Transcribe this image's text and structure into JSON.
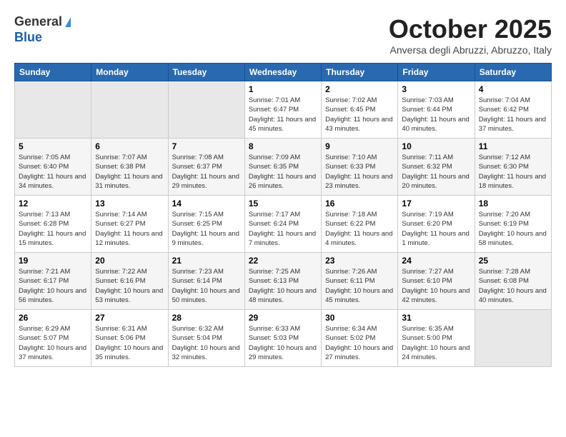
{
  "header": {
    "logo_general": "General",
    "logo_blue": "Blue",
    "month": "October 2025",
    "location": "Anversa degli Abruzzi, Abruzzo, Italy"
  },
  "days_of_week": [
    "Sunday",
    "Monday",
    "Tuesday",
    "Wednesday",
    "Thursday",
    "Friday",
    "Saturday"
  ],
  "weeks": [
    [
      {
        "day": "",
        "content": ""
      },
      {
        "day": "",
        "content": ""
      },
      {
        "day": "",
        "content": ""
      },
      {
        "day": "1",
        "content": "Sunrise: 7:01 AM\nSunset: 6:47 PM\nDaylight: 11 hours and 45 minutes."
      },
      {
        "day": "2",
        "content": "Sunrise: 7:02 AM\nSunset: 6:45 PM\nDaylight: 11 hours and 43 minutes."
      },
      {
        "day": "3",
        "content": "Sunrise: 7:03 AM\nSunset: 6:44 PM\nDaylight: 11 hours and 40 minutes."
      },
      {
        "day": "4",
        "content": "Sunrise: 7:04 AM\nSunset: 6:42 PM\nDaylight: 11 hours and 37 minutes."
      }
    ],
    [
      {
        "day": "5",
        "content": "Sunrise: 7:05 AM\nSunset: 6:40 PM\nDaylight: 11 hours and 34 minutes."
      },
      {
        "day": "6",
        "content": "Sunrise: 7:07 AM\nSunset: 6:38 PM\nDaylight: 11 hours and 31 minutes."
      },
      {
        "day": "7",
        "content": "Sunrise: 7:08 AM\nSunset: 6:37 PM\nDaylight: 11 hours and 29 minutes."
      },
      {
        "day": "8",
        "content": "Sunrise: 7:09 AM\nSunset: 6:35 PM\nDaylight: 11 hours and 26 minutes."
      },
      {
        "day": "9",
        "content": "Sunrise: 7:10 AM\nSunset: 6:33 PM\nDaylight: 11 hours and 23 minutes."
      },
      {
        "day": "10",
        "content": "Sunrise: 7:11 AM\nSunset: 6:32 PM\nDaylight: 11 hours and 20 minutes."
      },
      {
        "day": "11",
        "content": "Sunrise: 7:12 AM\nSunset: 6:30 PM\nDaylight: 11 hours and 18 minutes."
      }
    ],
    [
      {
        "day": "12",
        "content": "Sunrise: 7:13 AM\nSunset: 6:28 PM\nDaylight: 11 hours and 15 minutes."
      },
      {
        "day": "13",
        "content": "Sunrise: 7:14 AM\nSunset: 6:27 PM\nDaylight: 11 hours and 12 minutes."
      },
      {
        "day": "14",
        "content": "Sunrise: 7:15 AM\nSunset: 6:25 PM\nDaylight: 11 hours and 9 minutes."
      },
      {
        "day": "15",
        "content": "Sunrise: 7:17 AM\nSunset: 6:24 PM\nDaylight: 11 hours and 7 minutes."
      },
      {
        "day": "16",
        "content": "Sunrise: 7:18 AM\nSunset: 6:22 PM\nDaylight: 11 hours and 4 minutes."
      },
      {
        "day": "17",
        "content": "Sunrise: 7:19 AM\nSunset: 6:20 PM\nDaylight: 11 hours and 1 minute."
      },
      {
        "day": "18",
        "content": "Sunrise: 7:20 AM\nSunset: 6:19 PM\nDaylight: 10 hours and 58 minutes."
      }
    ],
    [
      {
        "day": "19",
        "content": "Sunrise: 7:21 AM\nSunset: 6:17 PM\nDaylight: 10 hours and 56 minutes."
      },
      {
        "day": "20",
        "content": "Sunrise: 7:22 AM\nSunset: 6:16 PM\nDaylight: 10 hours and 53 minutes."
      },
      {
        "day": "21",
        "content": "Sunrise: 7:23 AM\nSunset: 6:14 PM\nDaylight: 10 hours and 50 minutes."
      },
      {
        "day": "22",
        "content": "Sunrise: 7:25 AM\nSunset: 6:13 PM\nDaylight: 10 hours and 48 minutes."
      },
      {
        "day": "23",
        "content": "Sunrise: 7:26 AM\nSunset: 6:11 PM\nDaylight: 10 hours and 45 minutes."
      },
      {
        "day": "24",
        "content": "Sunrise: 7:27 AM\nSunset: 6:10 PM\nDaylight: 10 hours and 42 minutes."
      },
      {
        "day": "25",
        "content": "Sunrise: 7:28 AM\nSunset: 6:08 PM\nDaylight: 10 hours and 40 minutes."
      }
    ],
    [
      {
        "day": "26",
        "content": "Sunrise: 6:29 AM\nSunset: 5:07 PM\nDaylight: 10 hours and 37 minutes."
      },
      {
        "day": "27",
        "content": "Sunrise: 6:31 AM\nSunset: 5:06 PM\nDaylight: 10 hours and 35 minutes."
      },
      {
        "day": "28",
        "content": "Sunrise: 6:32 AM\nSunset: 5:04 PM\nDaylight: 10 hours and 32 minutes."
      },
      {
        "day": "29",
        "content": "Sunrise: 6:33 AM\nSunset: 5:03 PM\nDaylight: 10 hours and 29 minutes."
      },
      {
        "day": "30",
        "content": "Sunrise: 6:34 AM\nSunset: 5:02 PM\nDaylight: 10 hours and 27 minutes."
      },
      {
        "day": "31",
        "content": "Sunrise: 6:35 AM\nSunset: 5:00 PM\nDaylight: 10 hours and 24 minutes."
      },
      {
        "day": "",
        "content": ""
      }
    ]
  ]
}
